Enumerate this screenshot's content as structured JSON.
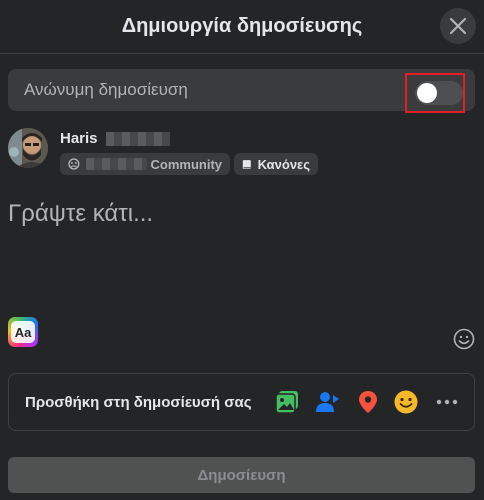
{
  "dialog": {
    "title": "Δημιουργία δημοσίευσης"
  },
  "anonymous": {
    "label": "Ανώνυμη δημοσίευση",
    "enabled": false
  },
  "author": {
    "name": "Haris"
  },
  "audience": {
    "community_label": "Community",
    "rules_label": "Κανόνες"
  },
  "composer": {
    "placeholder": "Γράψτε κάτι..."
  },
  "add_to_post": {
    "label": "Προσθήκη στη δημοσίευσή σας"
  },
  "submit": {
    "label": "Δημοσίευση"
  },
  "colors": {
    "background": "#242526",
    "surface": "#3a3b3c",
    "photo_green": "#45bd62",
    "tag_blue": "#1877f2",
    "location_red": "#f5533d",
    "feeling_yellow": "#f7b928",
    "highlight_red": "#e41e26"
  },
  "icons": [
    "close-icon",
    "toggle-switch",
    "globe-people-icon",
    "book-icon",
    "text-format-icon",
    "emoji-icon",
    "photo-video-icon",
    "tag-people-icon",
    "location-pin-icon",
    "feeling-icon",
    "more-icon"
  ]
}
